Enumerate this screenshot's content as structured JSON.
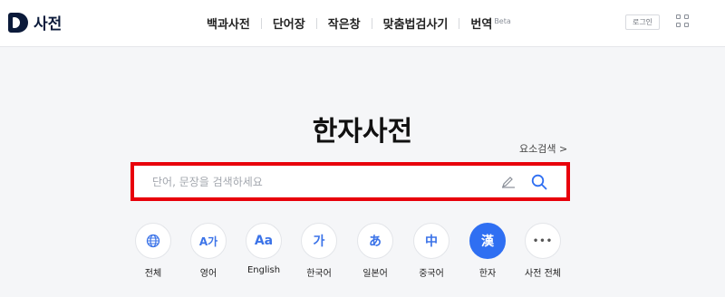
{
  "header": {
    "logo_text": "사전",
    "nav": [
      {
        "label": "백과사전"
      },
      {
        "label": "단어장"
      },
      {
        "label": "작은창"
      },
      {
        "label": "맞춤법검사기"
      },
      {
        "label": "번역",
        "badge": "Beta"
      }
    ],
    "login_label": "로그인",
    "apps_icon": "grid-icon"
  },
  "main": {
    "title": "한자사전",
    "advanced_search": "요소검색 >",
    "search": {
      "placeholder": "단어, 문장을 검색하세요",
      "value": ""
    }
  },
  "categories": [
    {
      "glyph": "🌐",
      "label": "전체",
      "icon": "globe-icon"
    },
    {
      "glyph": "A가",
      "label": "영어"
    },
    {
      "glyph": "Aa",
      "label": "English"
    },
    {
      "glyph": "가",
      "label": "한국어"
    },
    {
      "glyph": "あ",
      "label": "일본어"
    },
    {
      "glyph": "中",
      "label": "중국어"
    },
    {
      "glyph": "漢",
      "label": "한자",
      "active": true
    },
    {
      "glyph": "•••",
      "label": "사전 전체"
    }
  ],
  "colors": {
    "accent": "#2f6ff2",
    "highlight": "#e8000b",
    "logo": "#0b1a3a"
  }
}
